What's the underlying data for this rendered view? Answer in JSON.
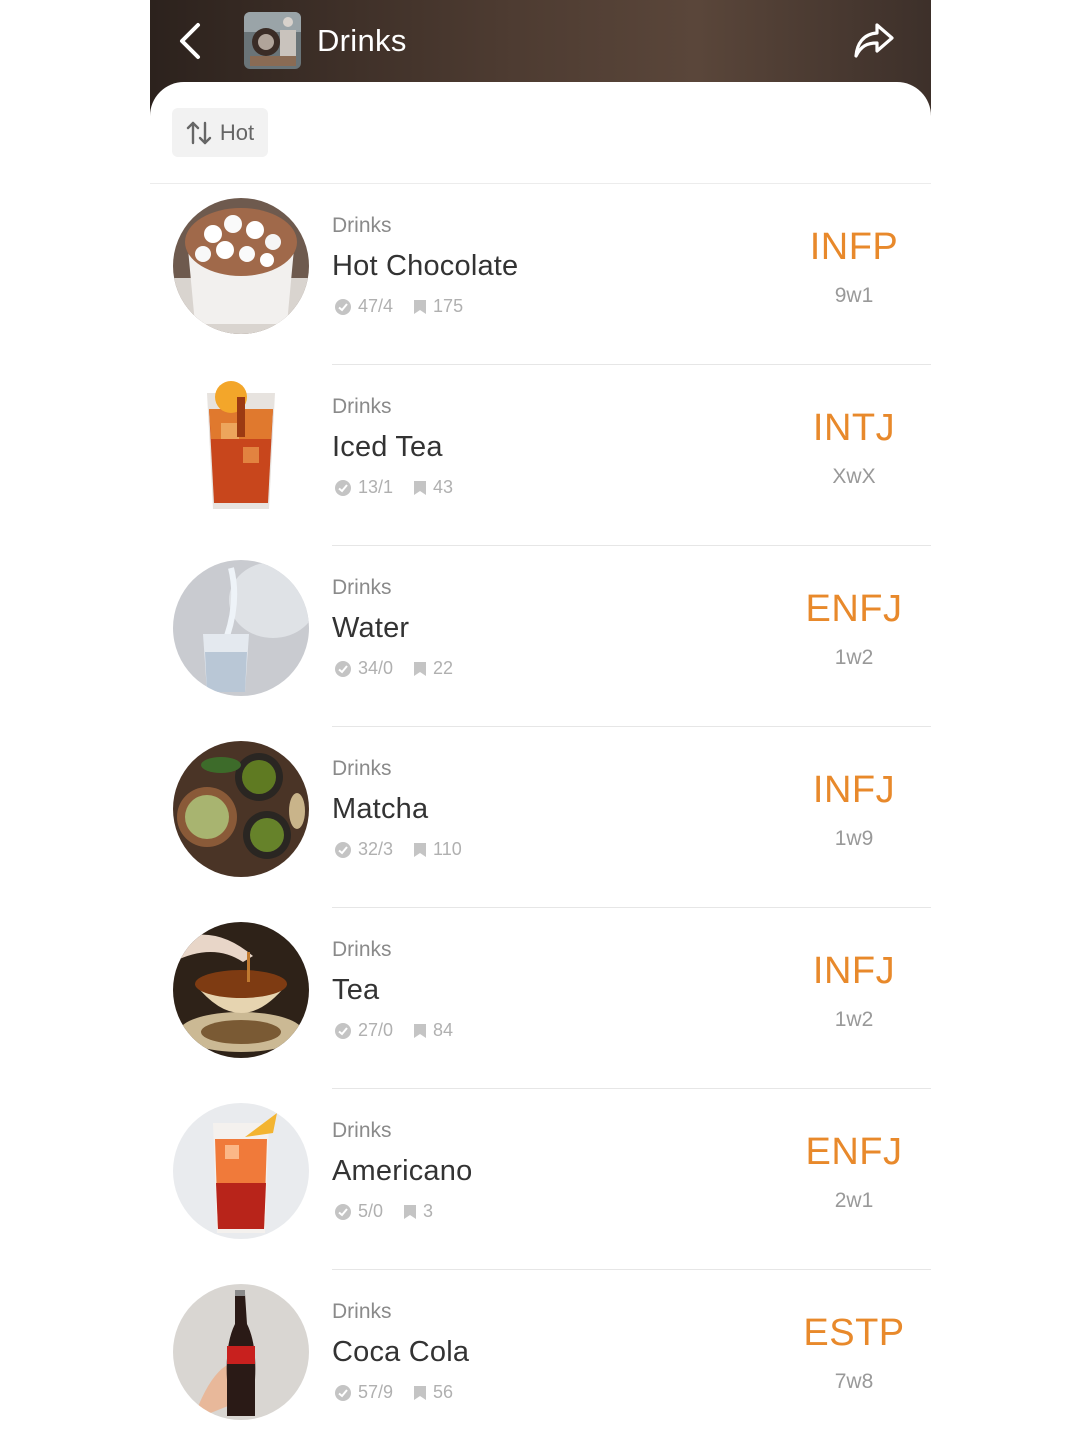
{
  "header": {
    "title": "Drinks",
    "back_icon": "chevron-left-icon",
    "share_icon": "share-arrow-icon"
  },
  "sort": {
    "label": "Hot",
    "icon": "sort-arrows-icon"
  },
  "colors": {
    "accent": "#e8892b",
    "header_bg": "#4d3b31"
  },
  "items": [
    {
      "category": "Drinks",
      "name": "Hot Chocolate",
      "votes": "47/4",
      "comments": "175",
      "type": "INFP",
      "wing": "9w1",
      "image": "hot-chocolate-image"
    },
    {
      "category": "Drinks",
      "name": "Iced Tea",
      "votes": "13/1",
      "comments": "43",
      "type": "INTJ",
      "wing": "XwX",
      "image": "iced-tea-image"
    },
    {
      "category": "Drinks",
      "name": "Water",
      "votes": "34/0",
      "comments": "22",
      "type": "ENFJ",
      "wing": "1w2",
      "image": "water-image"
    },
    {
      "category": "Drinks",
      "name": "Matcha",
      "votes": "32/3",
      "comments": "110",
      "type": "INFJ",
      "wing": "1w9",
      "image": "matcha-image"
    },
    {
      "category": "Drinks",
      "name": "Tea",
      "votes": "27/0",
      "comments": "84",
      "type": "INFJ",
      "wing": "1w2",
      "image": "tea-image"
    },
    {
      "category": "Drinks",
      "name": "Americano",
      "votes": "5/0",
      "comments": "3",
      "type": "ENFJ",
      "wing": "2w1",
      "image": "americano-image"
    },
    {
      "category": "Drinks",
      "name": "Coca Cola",
      "votes": "57/9",
      "comments": "56",
      "type": "ESTP",
      "wing": "7w8",
      "image": "coca-cola-image"
    }
  ]
}
